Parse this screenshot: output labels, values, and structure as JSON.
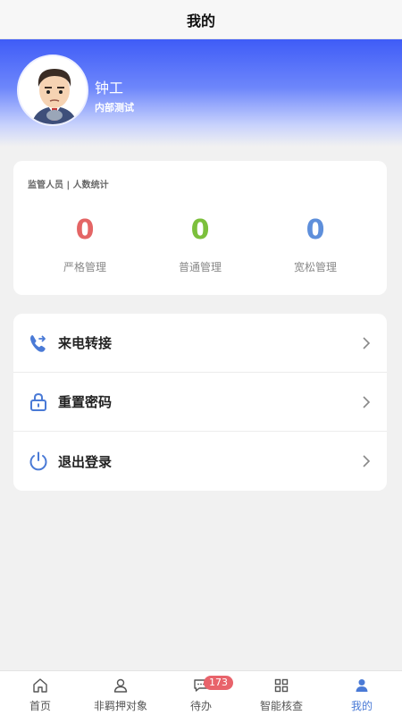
{
  "header": {
    "title": "我的"
  },
  "profile": {
    "name": "钟工",
    "tag": "内部测试"
  },
  "stats": {
    "caption": "监管人员 | 人数统计",
    "items": [
      {
        "value": "0",
        "label": "严格管理",
        "color": "#e46565"
      },
      {
        "value": "0",
        "label": "普通管理",
        "color": "#7cc03c"
      },
      {
        "value": "0",
        "label": "宽松管理",
        "color": "#5e8fdb"
      }
    ]
  },
  "menu": {
    "items": [
      {
        "label": "来电转接",
        "icon": "phone-forward-icon"
      },
      {
        "label": "重置密码",
        "icon": "lock-icon"
      },
      {
        "label": "退出登录",
        "icon": "power-icon"
      }
    ]
  },
  "tabbar": {
    "items": [
      {
        "label": "首页",
        "icon": "home-icon"
      },
      {
        "label": "非羁押对象",
        "icon": "user-outline-icon"
      },
      {
        "label": "待办",
        "icon": "chat-icon",
        "badge": "173"
      },
      {
        "label": "智能核查",
        "icon": "grid-icon"
      },
      {
        "label": "我的",
        "icon": "user-filled-icon",
        "active": true
      }
    ]
  },
  "colors": {
    "accent": "#4a7ad6",
    "hero_top": "#3f5cf7",
    "badge": "#e8636b"
  }
}
